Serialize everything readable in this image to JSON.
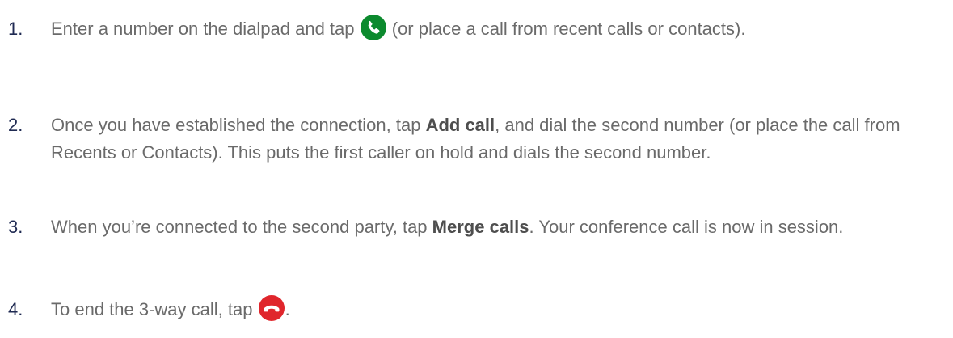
{
  "steps": [
    {
      "number": "1.",
      "before": "Enter a number on the dialpad and tap",
      "icon": "call-button-icon",
      "after": "(or place a call from recent calls or contacts)."
    },
    {
      "number": "2.",
      "before": "Once you have established the connection, tap",
      "bold": "Add call",
      "after": ", and dial the second number (or place the call from Recents or Contacts). This puts the first caller on hold and dials the second number."
    },
    {
      "number": "3.",
      "before": "When you’re connected to the second party, tap",
      "bold": "Merge calls",
      "after": ". Your conference call is now in session."
    },
    {
      "number": "4.",
      "before": "To end the 3-way call, tap",
      "icon": "end-call-icon",
      "after": "."
    }
  ],
  "colors": {
    "call_green": "#0c8a2e",
    "end_red": "#e0262c"
  }
}
